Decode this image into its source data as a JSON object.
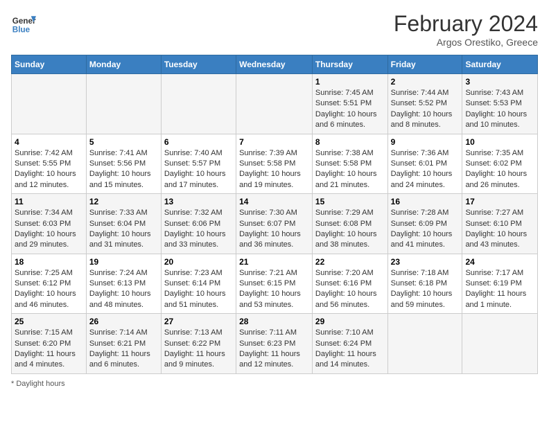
{
  "header": {
    "logo_line1": "General",
    "logo_line2": "Blue",
    "main_title": "February 2024",
    "subtitle": "Argos Orestiko, Greece"
  },
  "days_of_week": [
    "Sunday",
    "Monday",
    "Tuesday",
    "Wednesday",
    "Thursday",
    "Friday",
    "Saturday"
  ],
  "weeks": [
    [
      {
        "num": "",
        "info": ""
      },
      {
        "num": "",
        "info": ""
      },
      {
        "num": "",
        "info": ""
      },
      {
        "num": "",
        "info": ""
      },
      {
        "num": "1",
        "info": "Sunrise: 7:45 AM\nSunset: 5:51 PM\nDaylight: 10 hours\nand 6 minutes."
      },
      {
        "num": "2",
        "info": "Sunrise: 7:44 AM\nSunset: 5:52 PM\nDaylight: 10 hours\nand 8 minutes."
      },
      {
        "num": "3",
        "info": "Sunrise: 7:43 AM\nSunset: 5:53 PM\nDaylight: 10 hours\nand 10 minutes."
      }
    ],
    [
      {
        "num": "4",
        "info": "Sunrise: 7:42 AM\nSunset: 5:55 PM\nDaylight: 10 hours\nand 12 minutes."
      },
      {
        "num": "5",
        "info": "Sunrise: 7:41 AM\nSunset: 5:56 PM\nDaylight: 10 hours\nand 15 minutes."
      },
      {
        "num": "6",
        "info": "Sunrise: 7:40 AM\nSunset: 5:57 PM\nDaylight: 10 hours\nand 17 minutes."
      },
      {
        "num": "7",
        "info": "Sunrise: 7:39 AM\nSunset: 5:58 PM\nDaylight: 10 hours\nand 19 minutes."
      },
      {
        "num": "8",
        "info": "Sunrise: 7:38 AM\nSunset: 5:58 PM\nDaylight: 10 hours\nand 21 minutes."
      },
      {
        "num": "9",
        "info": "Sunrise: 7:36 AM\nSunset: 6:01 PM\nDaylight: 10 hours\nand 24 minutes."
      },
      {
        "num": "10",
        "info": "Sunrise: 7:35 AM\nSunset: 6:02 PM\nDaylight: 10 hours\nand 26 minutes."
      }
    ],
    [
      {
        "num": "11",
        "info": "Sunrise: 7:34 AM\nSunset: 6:03 PM\nDaylight: 10 hours\nand 29 minutes."
      },
      {
        "num": "12",
        "info": "Sunrise: 7:33 AM\nSunset: 6:04 PM\nDaylight: 10 hours\nand 31 minutes."
      },
      {
        "num": "13",
        "info": "Sunrise: 7:32 AM\nSunset: 6:06 PM\nDaylight: 10 hours\nand 33 minutes."
      },
      {
        "num": "14",
        "info": "Sunrise: 7:30 AM\nSunset: 6:07 PM\nDaylight: 10 hours\nand 36 minutes."
      },
      {
        "num": "15",
        "info": "Sunrise: 7:29 AM\nSunset: 6:08 PM\nDaylight: 10 hours\nand 38 minutes."
      },
      {
        "num": "16",
        "info": "Sunrise: 7:28 AM\nSunset: 6:09 PM\nDaylight: 10 hours\nand 41 minutes."
      },
      {
        "num": "17",
        "info": "Sunrise: 7:27 AM\nSunset: 6:10 PM\nDaylight: 10 hours\nand 43 minutes."
      }
    ],
    [
      {
        "num": "18",
        "info": "Sunrise: 7:25 AM\nSunset: 6:12 PM\nDaylight: 10 hours\nand 46 minutes."
      },
      {
        "num": "19",
        "info": "Sunrise: 7:24 AM\nSunset: 6:13 PM\nDaylight: 10 hours\nand 48 minutes."
      },
      {
        "num": "20",
        "info": "Sunrise: 7:23 AM\nSunset: 6:14 PM\nDaylight: 10 hours\nand 51 minutes."
      },
      {
        "num": "21",
        "info": "Sunrise: 7:21 AM\nSunset: 6:15 PM\nDaylight: 10 hours\nand 53 minutes."
      },
      {
        "num": "22",
        "info": "Sunrise: 7:20 AM\nSunset: 6:16 PM\nDaylight: 10 hours\nand 56 minutes."
      },
      {
        "num": "23",
        "info": "Sunrise: 7:18 AM\nSunset: 6:18 PM\nDaylight: 10 hours\nand 59 minutes."
      },
      {
        "num": "24",
        "info": "Sunrise: 7:17 AM\nSunset: 6:19 PM\nDaylight: 11 hours\nand 1 minute."
      }
    ],
    [
      {
        "num": "25",
        "info": "Sunrise: 7:15 AM\nSunset: 6:20 PM\nDaylight: 11 hours\nand 4 minutes."
      },
      {
        "num": "26",
        "info": "Sunrise: 7:14 AM\nSunset: 6:21 PM\nDaylight: 11 hours\nand 6 minutes."
      },
      {
        "num": "27",
        "info": "Sunrise: 7:13 AM\nSunset: 6:22 PM\nDaylight: 11 hours\nand 9 minutes."
      },
      {
        "num": "28",
        "info": "Sunrise: 7:11 AM\nSunset: 6:23 PM\nDaylight: 11 hours\nand 12 minutes."
      },
      {
        "num": "29",
        "info": "Sunrise: 7:10 AM\nSunset: 6:24 PM\nDaylight: 11 hours\nand 14 minutes."
      },
      {
        "num": "",
        "info": ""
      },
      {
        "num": "",
        "info": ""
      }
    ]
  ],
  "footer": {
    "note": "Daylight hours"
  }
}
